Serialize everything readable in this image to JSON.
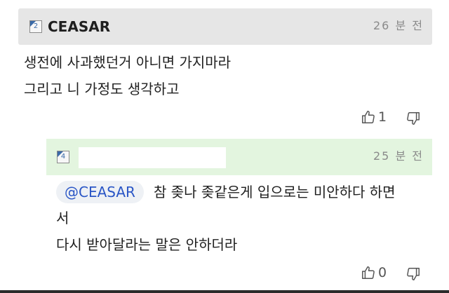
{
  "comment": {
    "username": "CEASAR",
    "level": "2",
    "timestamp": "26 분 전",
    "lines": [
      "생전에 사과했던거 아니면 가지마라",
      "그리고 니 가정도 생각하고"
    ],
    "like_count": "1"
  },
  "reply": {
    "level": "4",
    "timestamp": "25 분 전",
    "mention": "@CEASAR",
    "line1": "참 좆나 좆같은게 입으로는 미안하다 하면",
    "line2": "서",
    "line3": "다시 받아달라는 말은 안하더라",
    "like_count": "0"
  },
  "colors": {
    "header_bg": "#e6e6e6",
    "reply_header_bg": "#e3f5df",
    "mention_text": "#2a56c6",
    "muted_text": "#8a8a8a"
  },
  "icons": {
    "like": "thumbs-up-icon",
    "dislike": "thumbs-down-icon",
    "level": "level-badge-icon"
  }
}
